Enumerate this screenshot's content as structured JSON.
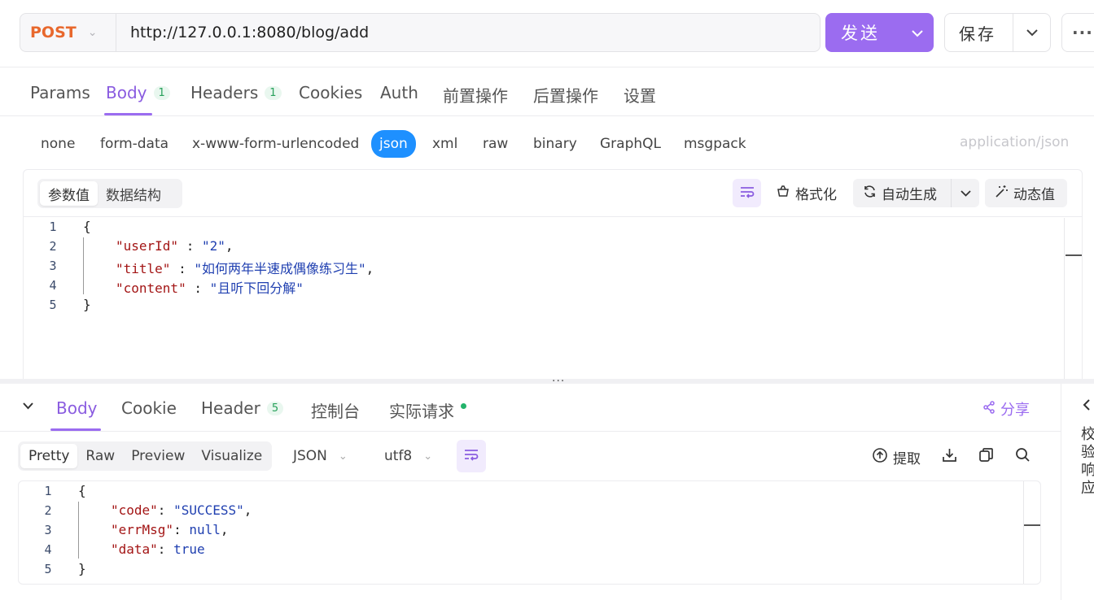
{
  "request": {
    "method": "POST",
    "url": "http://127.0.0.1:8080/blog/add",
    "send_label": "发送",
    "save_label": "保存",
    "more_label": "···"
  },
  "req_tabs": [
    {
      "label": "Params"
    },
    {
      "label": "Body",
      "badge": "1"
    },
    {
      "label": "Headers",
      "badge": "1"
    },
    {
      "label": "Cookies"
    },
    {
      "label": "Auth"
    },
    {
      "label": "前置操作"
    },
    {
      "label": "后置操作"
    },
    {
      "label": "设置"
    }
  ],
  "body_types": [
    "none",
    "form-data",
    "x-www-form-urlencoded",
    "json",
    "xml",
    "raw",
    "binary",
    "GraphQL",
    "msgpack"
  ],
  "content_type": "application/json",
  "editor": {
    "seg": [
      "参数值",
      "数据结构"
    ],
    "format_label": "格式化",
    "autogen_label": "自动生成",
    "dynamic_label": "动态值",
    "line_numbers": [
      "1",
      "2",
      "3",
      "4",
      "5"
    ],
    "json": {
      "open": "{",
      "k1": "\"userId\"",
      "v1": "\"2\"",
      "k2": "\"title\"",
      "v2": "\"如何两年半速成偶像练习生\"",
      "k3": "\"content\"",
      "v3": "\"且听下回分解\"",
      "close": "}"
    }
  },
  "response": {
    "tabs": [
      {
        "label": "Body"
      },
      {
        "label": "Cookie"
      },
      {
        "label": "Header",
        "badge": "5"
      },
      {
        "label": "控制台"
      },
      {
        "label": "实际请求"
      }
    ],
    "share_label": "分享",
    "side_label": "校验响应",
    "view_modes": [
      "Pretty",
      "Raw",
      "Preview",
      "Visualize"
    ],
    "format": "JSON",
    "encoding": "utf8",
    "extract_label": "提取",
    "line_numbers": [
      "1",
      "2",
      "3",
      "4",
      "5"
    ],
    "json": {
      "open": "{",
      "k1": "\"code\"",
      "v1": "\"SUCCESS\"",
      "k2": "\"errMsg\"",
      "v2": "null",
      "k3": "\"data\"",
      "v3": "true",
      "close": "}"
    }
  },
  "colors": {
    "accent": "#9b6cf0",
    "method": "#e8682d",
    "json_active": "#1e90ff",
    "status_dot": "#23b36b"
  }
}
